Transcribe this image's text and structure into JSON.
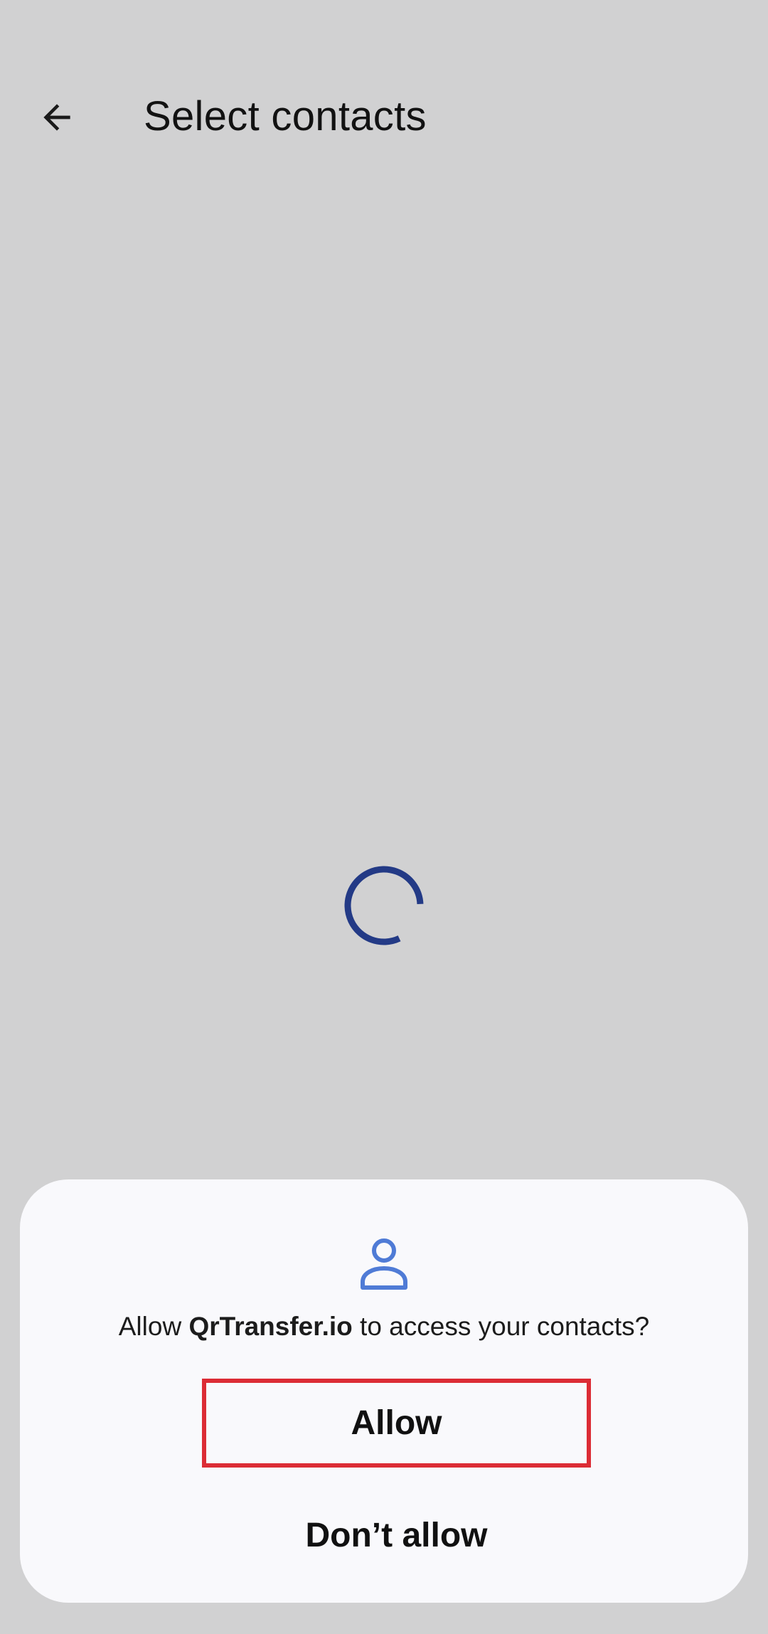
{
  "header": {
    "title": "Select contacts",
    "back_icon": "arrow-back-icon"
  },
  "loading": {
    "icon": "loading-spinner",
    "color": "#233a86"
  },
  "permission_dialog": {
    "icon": "person-icon",
    "icon_color": "#4f7bd6",
    "message_prefix": "Allow ",
    "app_name": "QrTransfer.io",
    "message_suffix": " to access your contacts?",
    "allow_label": "Allow",
    "deny_label": "Don’t allow",
    "highlight_color": "#dc2c35"
  }
}
